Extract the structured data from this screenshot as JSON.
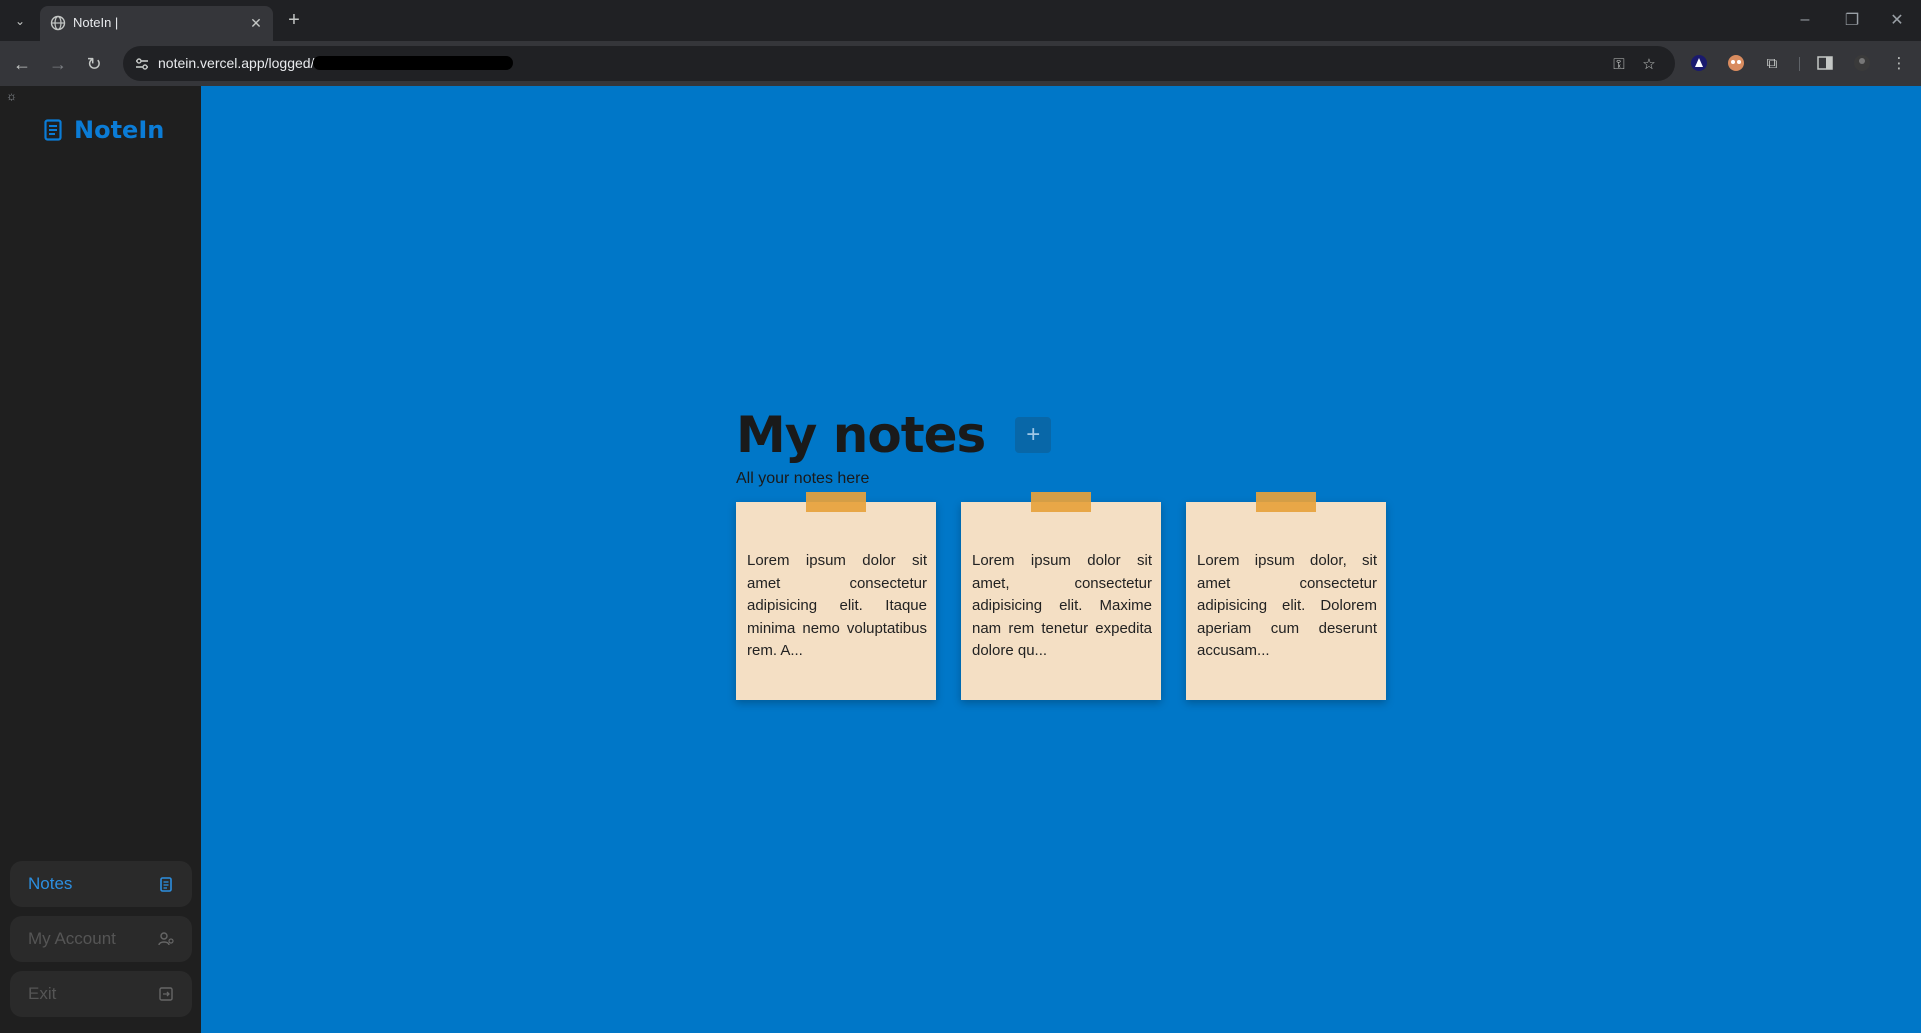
{
  "browser": {
    "tab_title": "NoteIn |",
    "url": "notein.vercel.app/logged/"
  },
  "sidebar": {
    "brand": "NoteIn",
    "nav": [
      {
        "label": "Notes",
        "icon": "notes-icon",
        "active": true
      },
      {
        "label": "My Account",
        "icon": "account-icon",
        "active": false
      },
      {
        "label": "Exit",
        "icon": "exit-icon",
        "active": false
      }
    ]
  },
  "main": {
    "title": "My notes",
    "subtitle": "All your notes here",
    "notes": [
      {
        "text": "Lorem ipsum dolor sit amet consectetur adipisicing elit. Itaque minima nemo voluptatibus rem. A..."
      },
      {
        "text": "Lorem ipsum dolor sit amet, consectetur adipisicing elit. Maxime nam rem tenetur expedita dolore qu..."
      },
      {
        "text": "Lorem ipsum dolor, sit amet consectetur adipisicing elit. Dolorem aperiam cum deserunt accusam..."
      }
    ]
  },
  "colors": {
    "page_bg": "#0077c8",
    "sidebar_bg": "#1f1f1f",
    "brand": "#0b7cd6",
    "note_bg": "#f4dfc4",
    "tape": "#e6a23c"
  }
}
